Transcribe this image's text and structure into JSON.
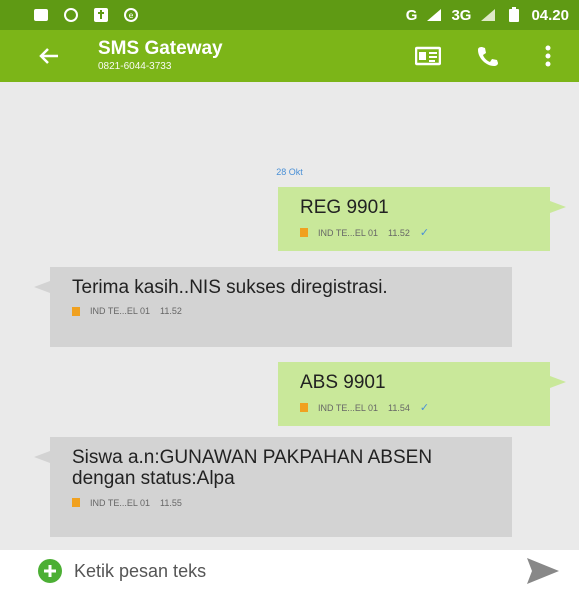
{
  "status_bar": {
    "network": "G",
    "network_3g": "3G",
    "time": "04.20"
  },
  "app_bar": {
    "title": "SMS Gateway",
    "subtitle": "0821-6044-3733"
  },
  "thread": {
    "date": "28 Okt",
    "messages": [
      {
        "direction": "out",
        "text": "REG 9901",
        "sim": "IND TE...EL 01",
        "time": "11.52"
      },
      {
        "direction": "in",
        "text": "Terima kasih..NIS sukses diregistrasi.",
        "sim": "IND TE...EL 01",
        "time": "11.52"
      },
      {
        "direction": "out",
        "text": "ABS 9901",
        "sim": "IND TE...EL 01",
        "time": "11.54"
      },
      {
        "direction": "in",
        "text": "Siswa a.n:GUNAWAN PAKPAHAN ABSEN dengan status:Alpa",
        "sim": "IND TE...EL 01",
        "time": "11.55"
      }
    ]
  },
  "input": {
    "placeholder": "Ketik pesan teks"
  },
  "colors": {
    "status_bar": "#5f9a14",
    "app_bar": "#7cb518",
    "outgoing_bubble": "#c9e89a",
    "incoming_bubble": "#d3d3d3",
    "date_label": "#4a90d6"
  },
  "icons": {
    "back": "arrow-left-icon",
    "contact_card": "contact-card-icon",
    "phone": "phone-icon",
    "menu": "more-vert-icon",
    "add": "add-circle-icon",
    "send": "send-icon"
  }
}
